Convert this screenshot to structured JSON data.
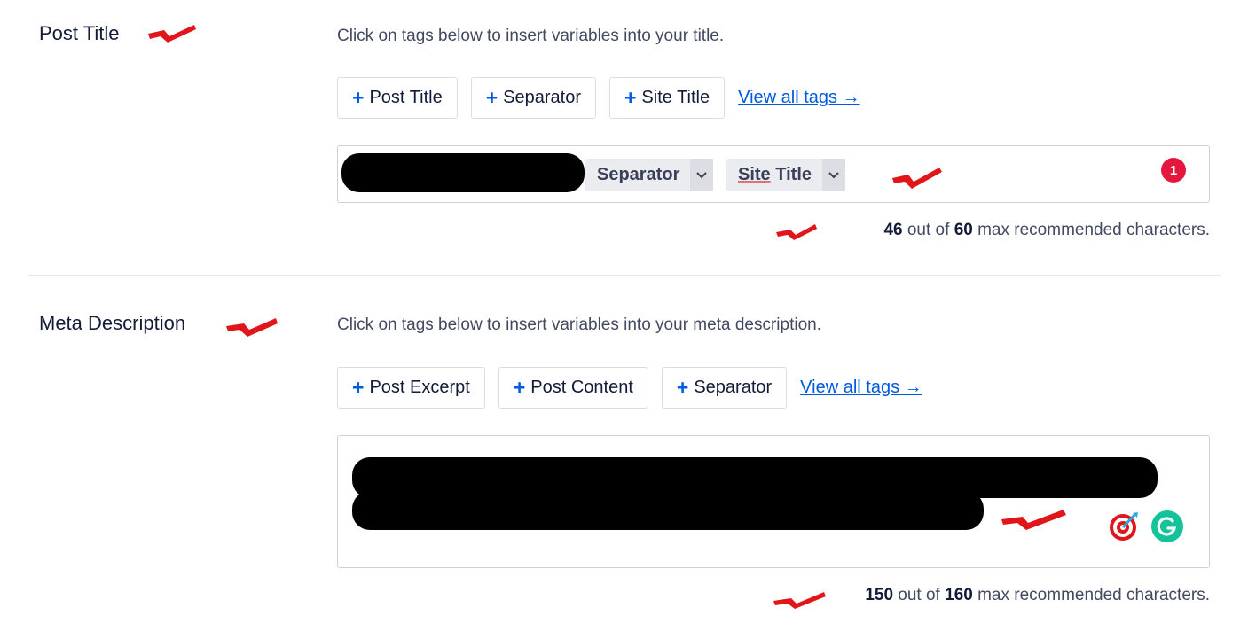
{
  "post_title": {
    "label": "Post Title",
    "hint": "Click on tags below to insert variables into your title.",
    "tags": [
      "Post Title",
      "Separator",
      "Site Title"
    ],
    "view_all": "View all tags →",
    "chips": [
      "Separator",
      "Site Title"
    ],
    "chip_site_underlined": "Site",
    "chip_site_rest": " Title",
    "badge": "1",
    "counter": {
      "current": "46",
      "middle": " out of ",
      "max": "60",
      "suffix": " max recommended characters."
    }
  },
  "meta_description": {
    "label": "Meta Description",
    "hint": "Click on tags below to insert variables into your meta description.",
    "tags": [
      "Post Excerpt",
      "Post Content",
      "Separator"
    ],
    "view_all": "View all tags →",
    "counter": {
      "current": "150",
      "middle": " out of ",
      "max": "160",
      "suffix": " max recommended characters."
    }
  },
  "colors": {
    "accent": "#005ae0",
    "annotation_red": "#e0161b",
    "badge_red": "#e4173e",
    "grammarly_green": "#15c39a"
  },
  "icons": [
    "plus-icon",
    "chevron-down-icon",
    "target-icon",
    "grammarly-icon",
    "check-annotation-icon"
  ]
}
